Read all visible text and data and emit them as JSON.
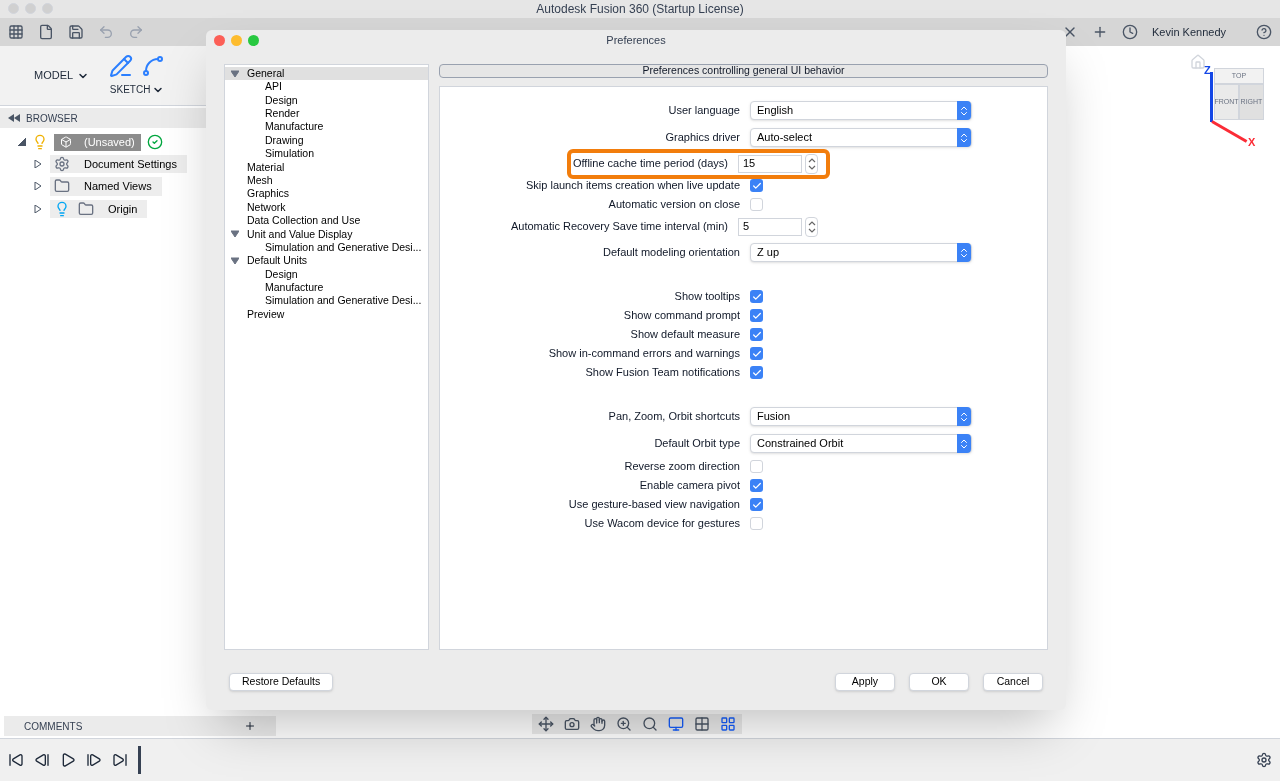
{
  "window": {
    "title": "Autodesk Fusion 360 (Startup License)"
  },
  "toolbar": {
    "user": "Kevin Kennedy"
  },
  "ribbon": {
    "workspace": "MODEL",
    "sketch": "SKETCH"
  },
  "browser": {
    "title": "BROWSER",
    "items": [
      {
        "label": "(Unsaved)",
        "expanded": true,
        "children": [
          {
            "label": "Document Settings",
            "kind": "settings",
            "expanded": false
          },
          {
            "label": "Named Views",
            "kind": "folder",
            "expanded": false
          },
          {
            "label": "Origin",
            "kind": "origin",
            "expanded": false
          }
        ]
      }
    ]
  },
  "viewcube": {
    "top": "TOP",
    "front": "FRONT",
    "right": "RIGHT",
    "z": "Z",
    "x": "X"
  },
  "comments": {
    "title": "COMMENTS"
  },
  "dialog": {
    "title": "Preferences",
    "tree": [
      {
        "label": "General",
        "selected": true,
        "expanded": true,
        "children": [
          {
            "label": "API",
            "selected": false
          },
          {
            "label": "Design",
            "selected": false
          },
          {
            "label": "Render",
            "selected": false
          },
          {
            "label": "Manufacture",
            "selected": false
          },
          {
            "label": "Drawing",
            "selected": false
          },
          {
            "label": "Simulation",
            "selected": false
          }
        ]
      },
      {
        "label": "Material",
        "selected": false
      },
      {
        "label": "Mesh",
        "selected": false
      },
      {
        "label": "Graphics",
        "selected": false
      },
      {
        "label": "Network",
        "selected": false
      },
      {
        "label": "Data Collection and Use",
        "selected": false
      },
      {
        "label": "Unit and Value Display",
        "selected": false,
        "expanded": true,
        "children": [
          {
            "label": "Simulation and Generative Desi...",
            "selected": false
          }
        ]
      },
      {
        "label": "Default Units",
        "selected": false,
        "expanded": true,
        "children": [
          {
            "label": "Design",
            "selected": false
          },
          {
            "label": "Manufacture",
            "selected": false
          },
          {
            "label": "Simulation and Generative Desi...",
            "selected": false
          }
        ]
      },
      {
        "label": "Preview",
        "selected": false
      }
    ],
    "header": "Preferences controlling general UI behavior",
    "settings": [
      {
        "kind": "select",
        "label": "User language",
        "value": "English"
      },
      {
        "kind": "select",
        "label": "Graphics driver",
        "value": "Auto-select"
      },
      {
        "kind": "spinner",
        "label": "Offline cache time period (days)",
        "value": "15",
        "highlighted": true
      },
      {
        "kind": "checkbox",
        "label": "Skip launch items creation when live update",
        "checked": true
      },
      {
        "kind": "checkbox",
        "label": "Automatic version on close",
        "checked": false
      },
      {
        "kind": "spinner",
        "label": "Automatic Recovery Save time interval (min)",
        "value": "5",
        "highlighted": false
      },
      {
        "kind": "select",
        "label": "Default modeling orientation",
        "value": "Z up"
      },
      {
        "kind": "gap"
      },
      {
        "kind": "checkbox",
        "label": "Show tooltips",
        "checked": true
      },
      {
        "kind": "checkbox",
        "label": "Show command prompt",
        "checked": true
      },
      {
        "kind": "checkbox",
        "label": "Show default measure",
        "checked": true
      },
      {
        "kind": "checkbox",
        "label": "Show in-command errors and warnings",
        "checked": true
      },
      {
        "kind": "checkbox",
        "label": "Show Fusion Team notifications",
        "checked": true
      },
      {
        "kind": "gap"
      },
      {
        "kind": "select",
        "label": "Pan, Zoom, Orbit shortcuts",
        "value": "Fusion"
      },
      {
        "kind": "select",
        "label": "Default Orbit type",
        "value": "Constrained Orbit"
      },
      {
        "kind": "checkbox",
        "label": "Reverse zoom direction",
        "checked": false
      },
      {
        "kind": "checkbox",
        "label": "Enable camera pivot",
        "checked": true
      },
      {
        "kind": "checkbox",
        "label": "Use gesture-based view navigation",
        "checked": true
      },
      {
        "kind": "checkbox",
        "label": "Use Wacom device for gestures",
        "checked": false
      }
    ],
    "restore": "Restore Defaults",
    "buttons": [
      "Apply",
      "OK",
      "Cancel"
    ]
  }
}
